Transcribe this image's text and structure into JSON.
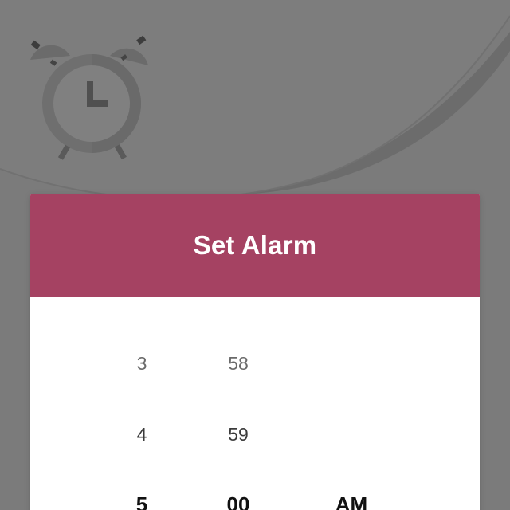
{
  "dialog": {
    "title": "Set Alarm"
  },
  "picker": {
    "hours": [
      "3",
      "4",
      "5"
    ],
    "minutes": [
      "58",
      "59",
      "00"
    ],
    "period": "AM",
    "selected": {
      "hour": "5",
      "minute": "00",
      "period": "AM"
    }
  },
  "colors": {
    "background": "#7b7b7b",
    "accent": "#a54262",
    "dialog": "#ffffff"
  },
  "icons": {
    "background_icon": "alarm-clock-icon"
  }
}
